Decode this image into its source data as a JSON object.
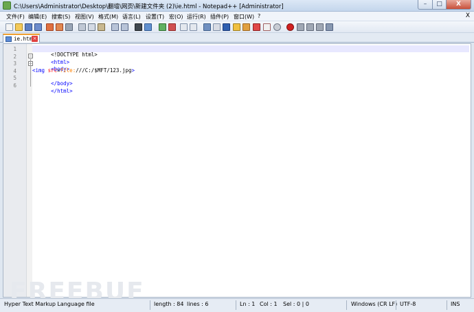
{
  "window": {
    "title": "C:\\Users\\Administrator\\Desktop\\翻墙\\网页\\新建文件夹 (2)\\ie.html - Notepad++ [Administrator]"
  },
  "window_controls": {
    "minimize": "–",
    "maximize": "□",
    "close": "X"
  },
  "menu": {
    "items": [
      "文件(F)",
      "编辑(E)",
      "搜索(S)",
      "视图(V)",
      "格式(M)",
      "语言(L)",
      "设置(T)",
      "宏(O)",
      "运行(R)",
      "插件(P)",
      "窗口(W)",
      "?"
    ],
    "close": "X"
  },
  "tab": {
    "label": "ie.html",
    "close": "×"
  },
  "editor": {
    "line_numbers": [
      "1",
      "2",
      "3",
      "4",
      "5",
      "6"
    ],
    "lines": [
      {
        "text": "<!DOCTYPE html>"
      },
      {
        "tag": "<html>"
      },
      {
        "tag": "<body>"
      },
      {
        "open": "<img ",
        "attr": "src",
        "eq": "=",
        "scheme": "file:",
        "rest": "///C:/$MFT/123.jpg",
        "close": ">"
      },
      {
        "tag": "</body>"
      },
      {
        "tag": "</html>"
      }
    ]
  },
  "statusbar": {
    "file_type": "Hyper Text Markup Language file",
    "length": "length : 84",
    "lines": "lines : 6",
    "ln": "Ln : 1",
    "col": "Col : 1",
    "sel": "Sel : 0 | 0",
    "eol": "Windows (CR LF)",
    "encoding": "UTF-8",
    "mode": "INS"
  },
  "watermark": "FREEBUF",
  "colors": {
    "tag": "#0000ff",
    "attribute": "#ff0000",
    "value": "#ff8000",
    "current_line": "#e8e8ff"
  }
}
